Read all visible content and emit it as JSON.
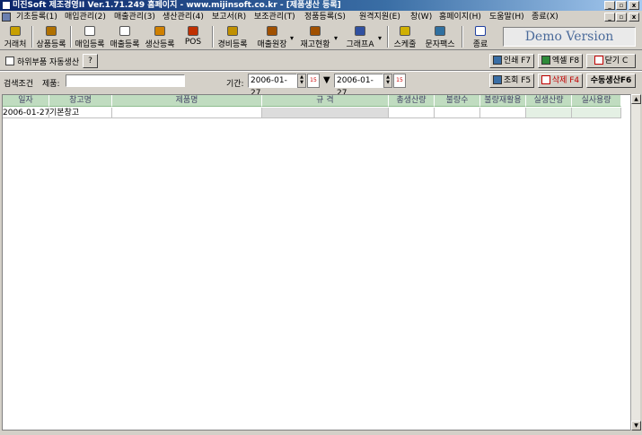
{
  "window": {
    "title": "미진Soft 제조경영II Ver.1.71.249     홈페이지 - www.mijinsoft.co.kr - [제품생산 등록]",
    "controls": {
      "minimize": "_",
      "restore": "▫",
      "close": "x"
    }
  },
  "menu": [
    "기초등록(1)",
    "매입관리(2)",
    "매출관리(3)",
    "생산관리(4)",
    "보고서(R)",
    "보조관리(T)",
    "정품등록(S)",
    "원격지원(E)",
    "창(W)",
    "홈페이지(H)",
    "도움말(H)",
    "종료(X)"
  ],
  "toolbar": {
    "buttons": [
      {
        "label": "거래처",
        "icon": "edit-icon",
        "color": "#c8a000"
      },
      {
        "label": "상품등록",
        "icon": "box-icon",
        "color": "#b07000"
      },
      {
        "label": "매입등록",
        "icon": "doc-icon",
        "color": "#606060"
      },
      {
        "label": "매출등록",
        "icon": "doc-icon",
        "color": "#606060"
      },
      {
        "label": "생산등록",
        "icon": "factory-icon",
        "color": "#d08000"
      },
      {
        "label": "POS",
        "icon": "pos-icon",
        "color": "#c03000"
      },
      {
        "label": "경비등록",
        "icon": "money-icon",
        "color": "#c09000"
      },
      {
        "label": "매출원장",
        "icon": "ledger-icon",
        "color": "#a05000"
      },
      {
        "label": "재고현황",
        "icon": "stock-icon",
        "color": "#a05000"
      },
      {
        "label": "그래프A",
        "icon": "chart-icon",
        "color": "#3050a0"
      },
      {
        "label": "스케줄",
        "icon": "clock-icon",
        "color": "#d0b000"
      },
      {
        "label": "문자팩스",
        "icon": "fax-icon",
        "color": "#3070a0"
      },
      {
        "label": "종료",
        "icon": "exit-icon",
        "color": "#2040a0"
      }
    ],
    "dropdown_arrow": "▾",
    "demo_badge": "Demo Version"
  },
  "options": {
    "subpart_label": "하위부품 자동생산",
    "help_label": "?",
    "print_label": "인쇄 F7",
    "excel_label": "엑셀 F8",
    "close_label": "닫기 C"
  },
  "search": {
    "section_label": "검색조건",
    "product_label": "제품:",
    "product_value": "",
    "period_label": "기간:",
    "date_from": "2006-01-27",
    "date_to": "2006-01-27",
    "calendar_label": "15",
    "arrow": "▼",
    "query_label": "조회 F5",
    "delete_label": "삭제 F4",
    "manual_label": "수동생산F6"
  },
  "table": {
    "columns": [
      "일자",
      "창고명",
      "제품명",
      "규 격",
      "총생산량",
      "불량수",
      "불량재활용",
      "실생산량",
      "실사용량"
    ],
    "rows": [
      {
        "date": "2006-01-27",
        "warehouse": "기본창고",
        "product": "",
        "spec": "",
        "total": "",
        "defect": "",
        "recycle": "",
        "actual": "",
        "used": ""
      }
    ]
  },
  "scrollbar": {
    "up": "▲",
    "down": "▼"
  }
}
